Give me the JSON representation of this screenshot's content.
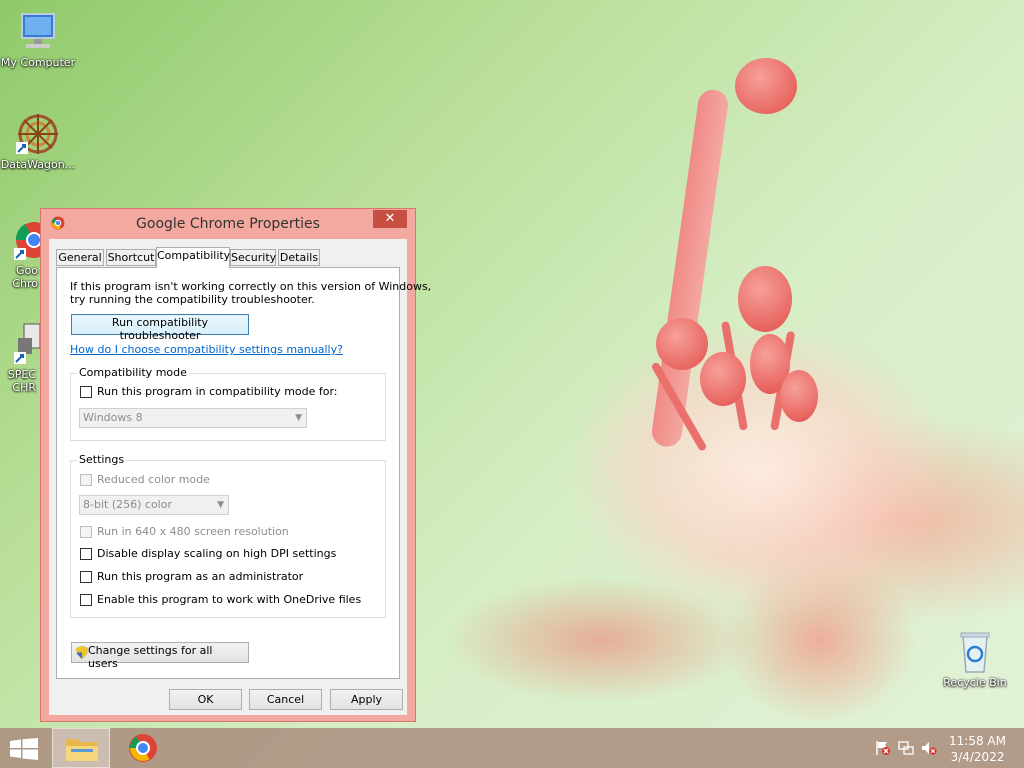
{
  "desktop": {
    "icons": [
      {
        "label": "My Computer"
      },
      {
        "label": "DataWagon..."
      },
      {
        "label": "Goo Chro"
      },
      {
        "label": "SPEC CHR"
      },
      {
        "label": "Recycle Bin"
      }
    ]
  },
  "dialog": {
    "title": "Google Chrome Properties",
    "close_glyph": "✕",
    "tabs": [
      {
        "label": "General"
      },
      {
        "label": "Shortcut"
      },
      {
        "label": "Compatibility",
        "active": true
      },
      {
        "label": "Security"
      },
      {
        "label": "Details"
      }
    ],
    "intro_line1": "If this program isn't working correctly on this version of Windows,",
    "intro_line2": "try running the compatibility troubleshooter.",
    "run_troubleshooter": "Run compatibility troubleshooter",
    "help_link": "How do I choose compatibility settings manually?",
    "compat_mode": {
      "group_label": "Compatibility mode",
      "checkbox_label": "Run this program in compatibility mode for:",
      "os_value": "Windows 8"
    },
    "settings": {
      "group_label": "Settings",
      "reduced_color": "Reduced color mode",
      "color_value": "8-bit (256) color",
      "resolution": "Run in 640 x 480 screen resolution",
      "dpi": "Disable display scaling on high DPI settings",
      "admin": "Run this program as an administrator",
      "onedrive": "Enable this program to work with OneDrive files"
    },
    "change_all_users": "Change settings for all users",
    "ok": "OK",
    "cancel": "Cancel",
    "apply": "Apply"
  },
  "taskbar": {
    "time": "11:58 AM",
    "date": "3/4/2022"
  }
}
